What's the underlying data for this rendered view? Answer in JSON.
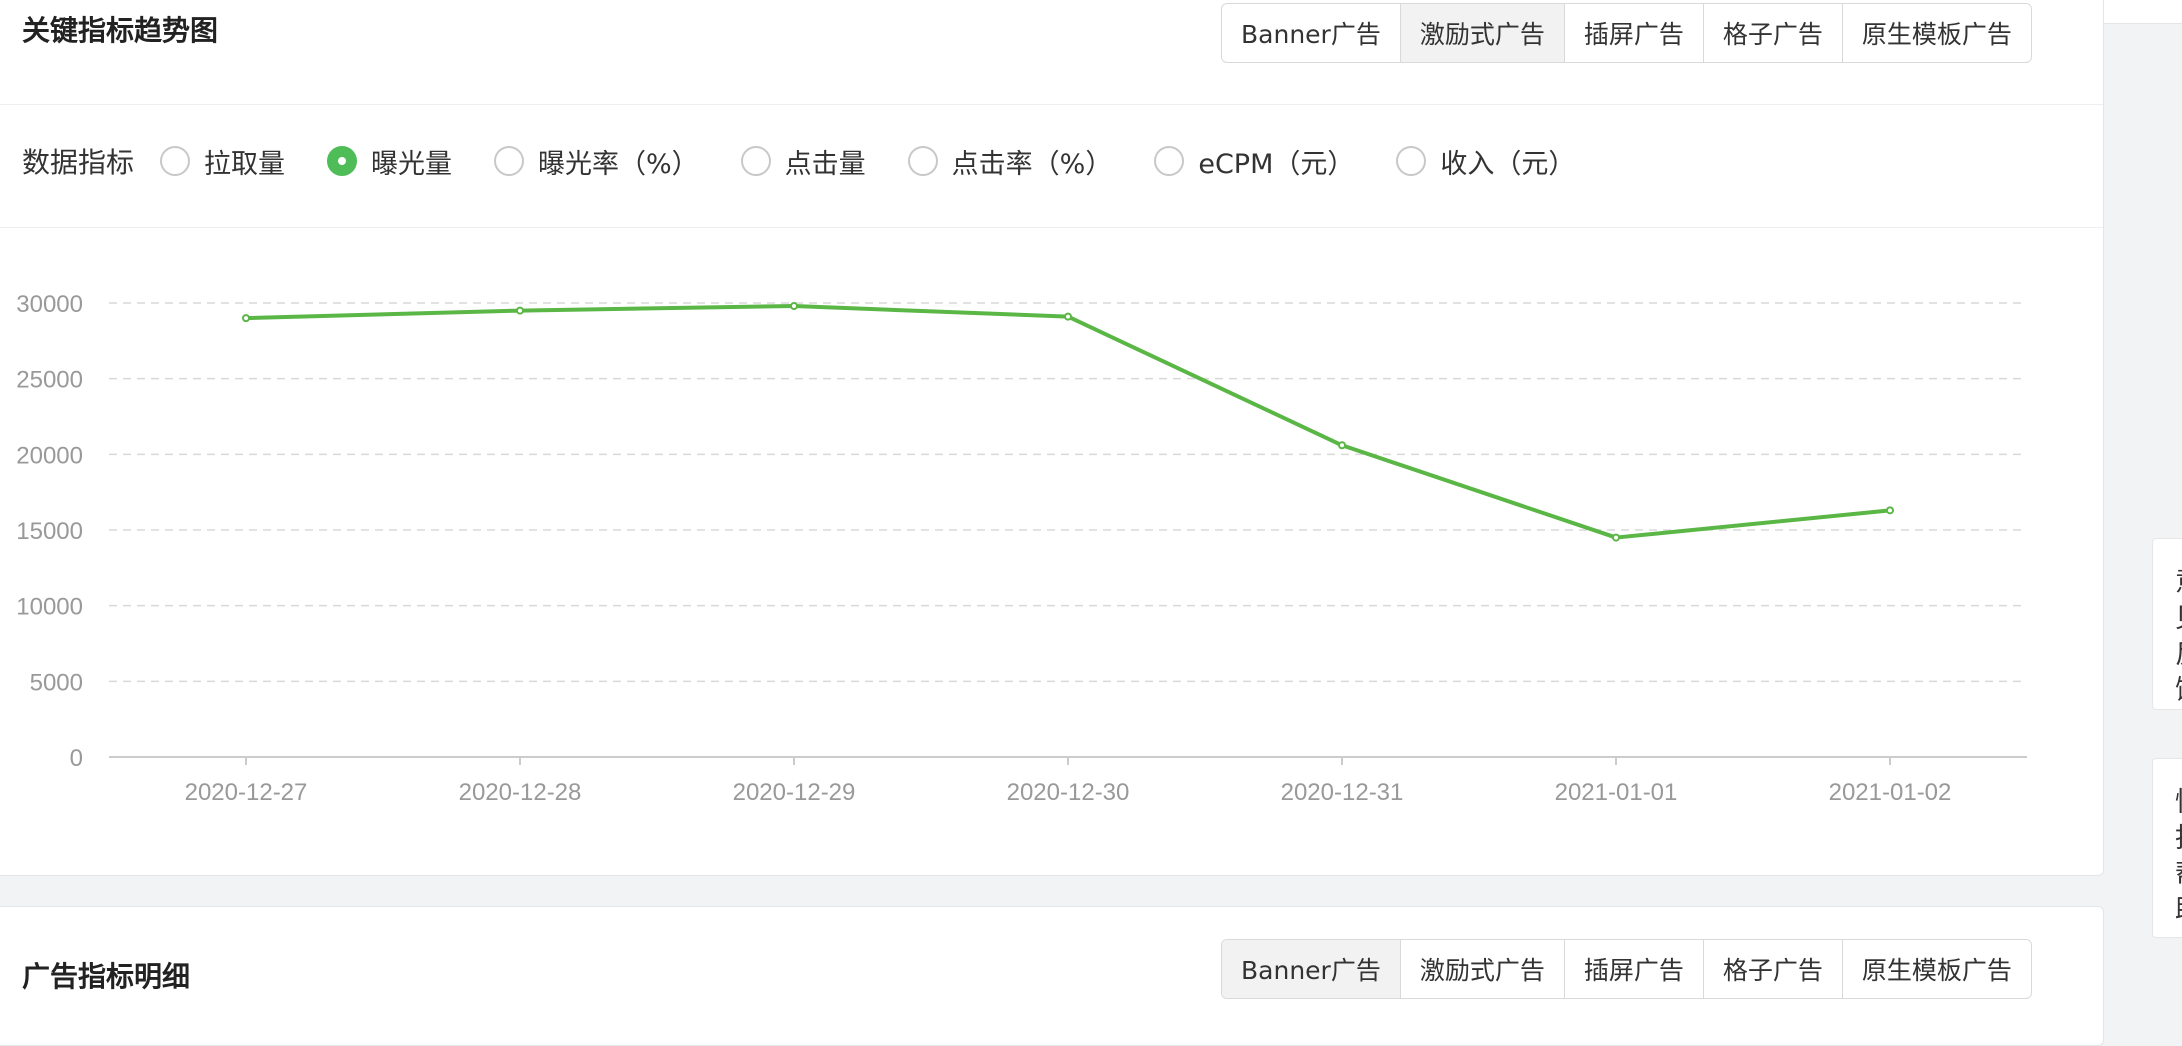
{
  "trend_card": {
    "title": "关键指标趋势图",
    "ad_tabs": [
      {
        "label": "Banner广告",
        "active": false
      },
      {
        "label": "激励式广告",
        "active": true
      },
      {
        "label": "插屏广告",
        "active": false
      },
      {
        "label": "格子广告",
        "active": false
      },
      {
        "label": "原生模板广告",
        "active": false
      }
    ],
    "metrics_label": "数据指标",
    "metrics": [
      {
        "label": "拉取量",
        "checked": false
      },
      {
        "label": "曝光量",
        "checked": true
      },
      {
        "label": "曝光率（%）",
        "checked": false
      },
      {
        "label": "点击量",
        "checked": false
      },
      {
        "label": "点击率（%）",
        "checked": false
      },
      {
        "label": "eCPM（元）",
        "checked": false
      },
      {
        "label": "收入（元）",
        "checked": false
      }
    ]
  },
  "chart_data": {
    "type": "line",
    "x": [
      "2020-12-27",
      "2020-12-28",
      "2020-12-29",
      "2020-12-30",
      "2020-12-31",
      "2021-01-01",
      "2021-01-02"
    ],
    "series": [
      {
        "values": [
          29000,
          29500,
          29800,
          29100,
          20600,
          14500,
          16300
        ],
        "color": "#5ab645"
      }
    ],
    "yticks": [
      0,
      5000,
      10000,
      15000,
      20000,
      25000,
      30000
    ],
    "ylim": [
      0,
      30000
    ],
    "grid": true,
    "colors": {
      "line": "#5ab645",
      "grid": "#d9d9d9",
      "axis": "#cccccc",
      "tick_text": "#999999"
    }
  },
  "detail_card": {
    "title": "广告指标明细",
    "ad_tabs": [
      {
        "label": "Banner广告",
        "active": true
      },
      {
        "label": "激励式广告",
        "active": false
      },
      {
        "label": "插屏广告",
        "active": false
      },
      {
        "label": "格子广告",
        "active": false
      },
      {
        "label": "原生模板广告",
        "active": false
      }
    ]
  },
  "side_panels": [
    {
      "chars": [
        "意",
        "见",
        "反",
        "馈"
      ]
    },
    {
      "chars": [
        "性",
        "指",
        "帮",
        "助"
      ]
    }
  ]
}
